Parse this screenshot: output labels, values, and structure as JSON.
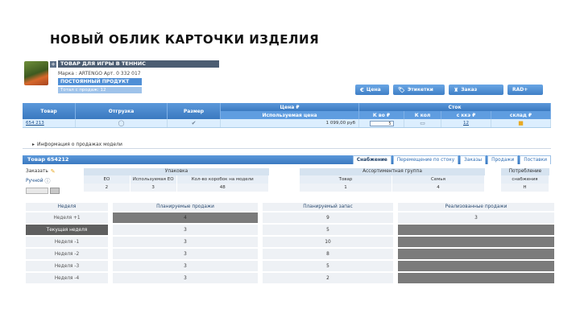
{
  "slide_title": "НОВЫЙ ОБЛИК КАРТОЧКИ ИЗДЕЛИЯ",
  "product": {
    "name": "ТОВАР ДЛЯ ИГРЫ В ТЕННИС",
    "brand_line": "Марка : ARTENGO   Арт. 0 332 017",
    "status": "ПОСТОЯННЫЙ ПРОДУКТ",
    "sub": "Тотал с продаж: 12"
  },
  "buttons": [
    {
      "label": "Цена",
      "icon": "euro-icon"
    },
    {
      "label": "Этикетки",
      "icon": "tag-icon"
    },
    {
      "label": "Заказ",
      "icon": "bell-icon"
    },
    {
      "label": "RAD+",
      "icon": "none"
    }
  ],
  "assort_table": {
    "headers_row1": [
      "Товар",
      "Отгрузка",
      "Размер",
      "Цена ₽",
      "Сток"
    ],
    "headers_row2": [
      "Используемая цена",
      "",
      "К во ₽",
      "К кол",
      "с ккэ ₽",
      "склад ₽"
    ],
    "row": {
      "item": "654 213",
      "price": "1 099,00 руб",
      "qty": "5",
      "stock_link": "12"
    }
  },
  "sales_info": "Информация о продажах модели",
  "model": {
    "title": "Товар 654212",
    "tabs": [
      "Снабжение",
      "Перемещение по стоку",
      "Заказы",
      "Продажи",
      "Поставки"
    ],
    "active_tab": "Снабжение"
  },
  "params": {
    "order_label": "Заказать",
    "manual_label": "Ручной",
    "packing_header": "Упаковка",
    "packing_cols": [
      "ЕО",
      "Используемая ЕО",
      "Кол-во коробок на модели"
    ],
    "packing_vals": [
      "2",
      "3",
      "48"
    ],
    "assort_header": "Ассортиментная группа",
    "assort_cols": [
      "Товар",
      "Семья"
    ],
    "assort_vals": [
      "1",
      "4"
    ],
    "consumption_header": "Потребление",
    "consumption_cols": [
      "снабжения"
    ],
    "consumption_vals": [
      "Н"
    ]
  },
  "weeks": {
    "headers": [
      "Неделя",
      "Планируемые продажи",
      "Планируемый запас",
      "Реализованные продажи"
    ],
    "rows": [
      {
        "label": "Неделя +1",
        "plan_sales": "4",
        "plan_stock": "9",
        "real_sales": "3"
      },
      {
        "label": "Текущая неделя",
        "plan_sales": "3",
        "plan_stock": "5",
        "real_sales": ""
      },
      {
        "label": "Неделя -1",
        "plan_sales": "3",
        "plan_stock": "10",
        "real_sales": ""
      },
      {
        "label": "Неделя -2",
        "plan_sales": "3",
        "plan_stock": "8",
        "real_sales": ""
      },
      {
        "label": "Неделя -3",
        "plan_sales": "3",
        "plan_stock": "5",
        "real_sales": ""
      },
      {
        "label": "Неделя -4",
        "plan_sales": "3",
        "plan_stock": "2",
        "real_sales": ""
      }
    ]
  }
}
